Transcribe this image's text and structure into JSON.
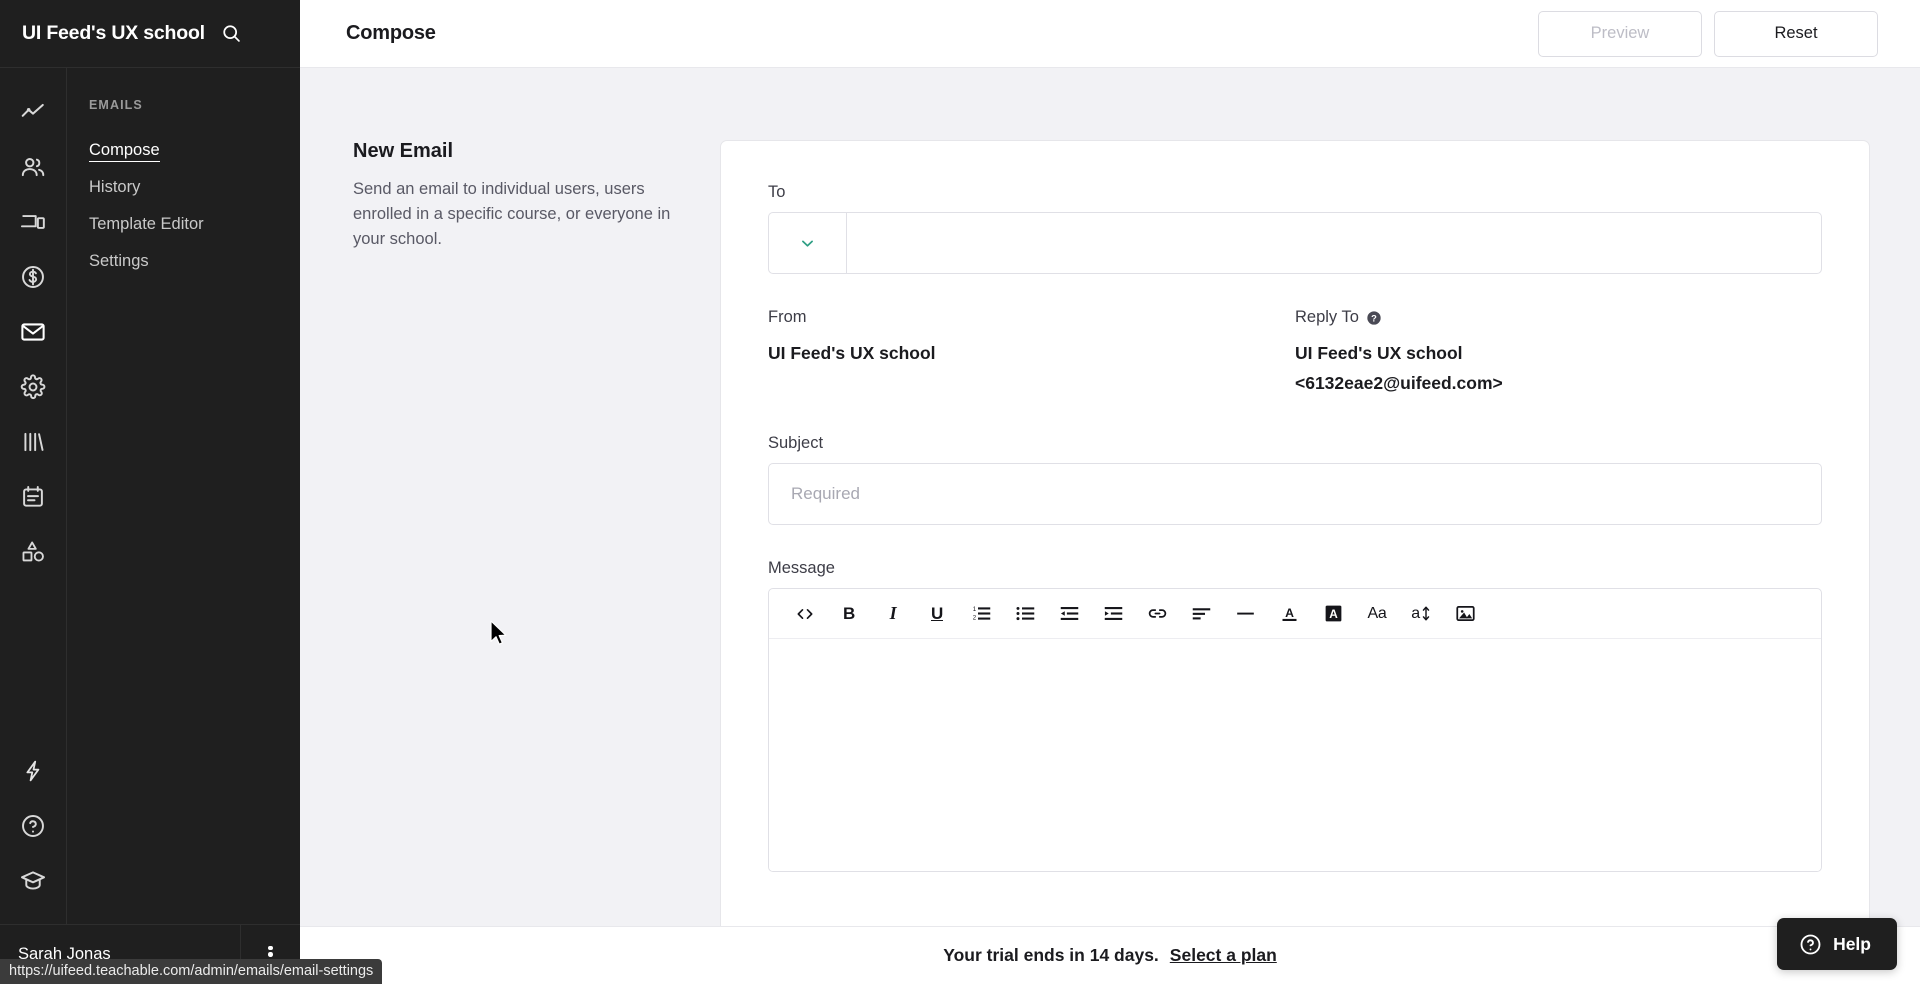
{
  "sidebar": {
    "school_name": "UI Feed's UX school",
    "search_icon": "search-icon",
    "rail_icons": [
      {
        "name": "analytics-icon",
        "label": "Analytics"
      },
      {
        "name": "users-icon",
        "label": "Users"
      },
      {
        "name": "site-icon",
        "label": "Site"
      },
      {
        "name": "sales-icon",
        "label": "Sales"
      },
      {
        "name": "emails-icon",
        "label": "Emails"
      },
      {
        "name": "settings-icon",
        "label": "Settings"
      },
      {
        "name": "library-icon",
        "label": "Library"
      },
      {
        "name": "calendar-icon",
        "label": "Calendar"
      },
      {
        "name": "shapes-icon",
        "label": "Design"
      }
    ],
    "rail_bottom_icons": [
      {
        "name": "lightning-icon",
        "label": "Upgrade"
      },
      {
        "name": "help-circle-icon",
        "label": "Help"
      },
      {
        "name": "graduation-cap-icon",
        "label": "Learn"
      }
    ],
    "section_title": "EMAILS",
    "items": [
      {
        "label": "Compose",
        "active": true
      },
      {
        "label": "History",
        "active": false
      },
      {
        "label": "Template Editor",
        "active": false
      },
      {
        "label": "Settings",
        "active": false
      }
    ],
    "user_name": "Sarah Jonas",
    "kebab_icon": "kebab-menu-icon"
  },
  "topbar": {
    "title": "Compose",
    "preview_label": "Preview",
    "reset_label": "Reset"
  },
  "description": {
    "title": "New Email",
    "body": "Send an email to individual users, users enrolled in a specific course, or everyone in your school."
  },
  "form": {
    "to": {
      "label": "To",
      "value": "",
      "placeholder": "",
      "chevron_icon": "chevron-down-icon",
      "chevron_color": "#2e9e84"
    },
    "from": {
      "label": "From",
      "value": "UI Feed's UX school"
    },
    "reply_to": {
      "label": "Reply To",
      "help_icon": "help-circle-icon",
      "name": "UI Feed's UX school",
      "email": "<6132eae2@uifeed.com>"
    },
    "subject": {
      "label": "Subject",
      "value": "",
      "placeholder": "Required"
    },
    "message": {
      "label": "Message",
      "value": "",
      "toolbar": [
        {
          "name": "code-icon",
          "glyph": "<>",
          "title": "Code"
        },
        {
          "name": "bold-icon",
          "glyph": "B",
          "title": "Bold"
        },
        {
          "name": "italic-icon",
          "glyph": "I",
          "title": "Italic"
        },
        {
          "name": "underline-icon",
          "glyph": "U",
          "title": "Underline"
        },
        {
          "name": "ordered-list-icon",
          "glyph": "",
          "title": "Ordered list"
        },
        {
          "name": "unordered-list-icon",
          "glyph": "",
          "title": "Bulleted list"
        },
        {
          "name": "outdent-icon",
          "glyph": "",
          "title": "Decrease indent"
        },
        {
          "name": "indent-icon",
          "glyph": "",
          "title": "Increase indent"
        },
        {
          "name": "link-icon",
          "glyph": "",
          "title": "Insert link"
        },
        {
          "name": "align-left-icon",
          "glyph": "",
          "title": "Align"
        },
        {
          "name": "horizontal-rule-icon",
          "glyph": "",
          "title": "Horizontal rule"
        },
        {
          "name": "text-color-icon",
          "glyph": "A",
          "title": "Text color"
        },
        {
          "name": "highlight-color-icon",
          "glyph": "A",
          "title": "Highlight color"
        },
        {
          "name": "font-size-icon",
          "glyph": "Aa",
          "title": "Font size"
        },
        {
          "name": "line-height-icon",
          "glyph": "a",
          "title": "Line height"
        },
        {
          "name": "insert-image-icon",
          "glyph": "",
          "title": "Insert image"
        }
      ]
    }
  },
  "footer": {
    "trial_text": "Your trial ends in 14 days.",
    "trial_link": "Select a plan"
  },
  "help_fab": {
    "label": "Help",
    "icon": "question-circle-icon"
  },
  "status_bar": {
    "url": "https://uifeed.teachable.com/admin/emails/email-settings"
  }
}
